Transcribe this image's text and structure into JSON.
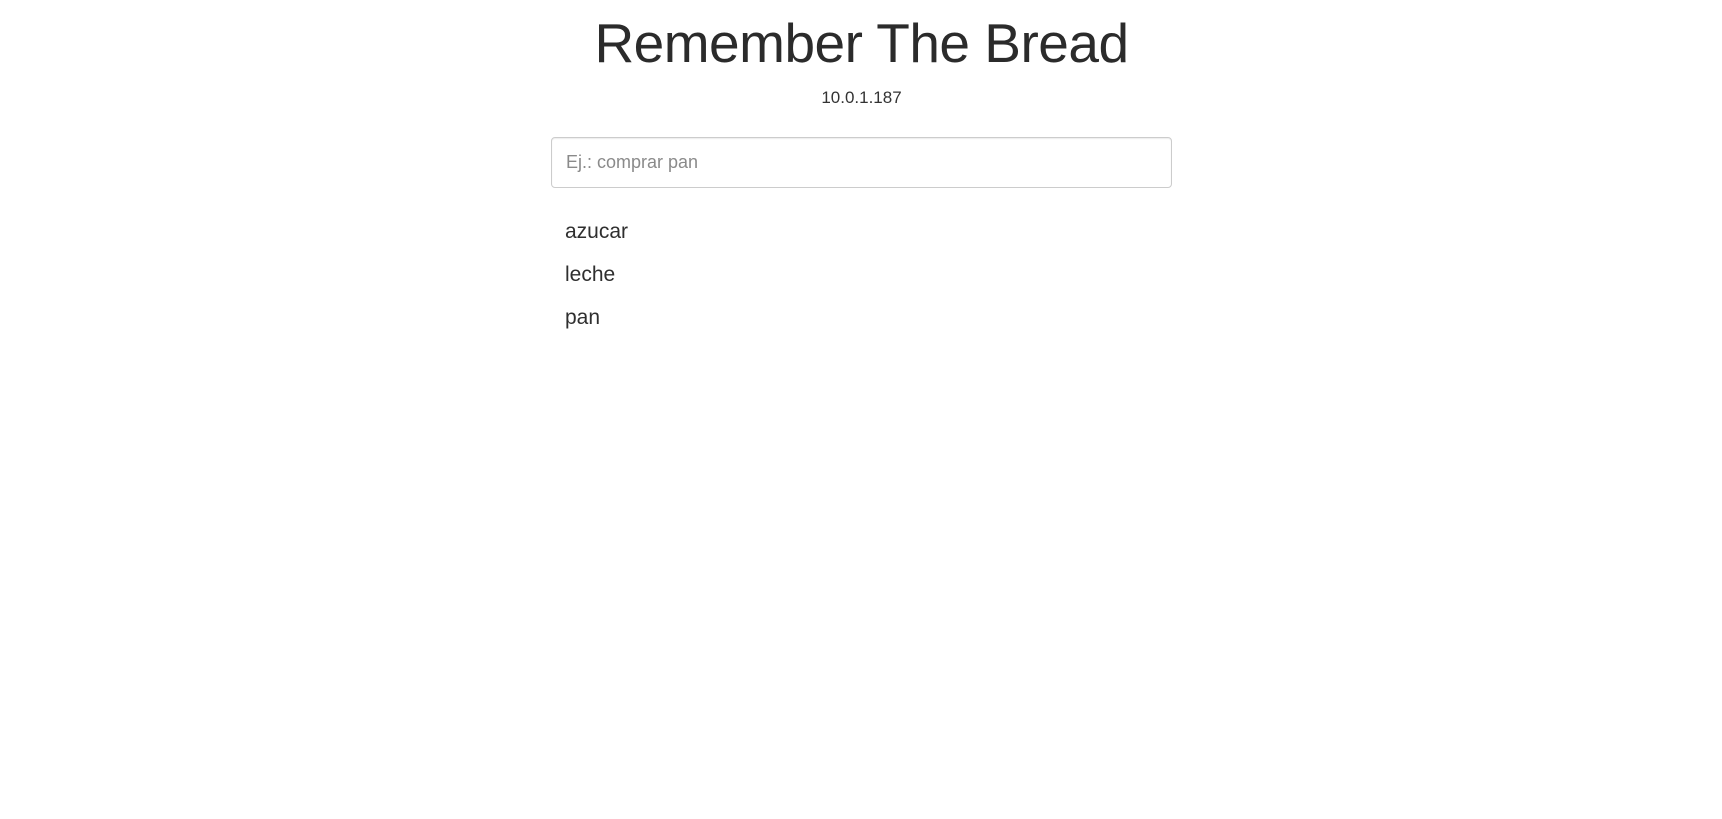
{
  "header": {
    "title": "Remember The Bread",
    "ip_address": "10.0.1.187"
  },
  "task_input": {
    "value": "",
    "placeholder": "Ej.: comprar pan"
  },
  "tasks": [
    {
      "label": "azucar"
    },
    {
      "label": "leche"
    },
    {
      "label": "pan"
    }
  ],
  "colors": {
    "background": "#ffffff",
    "text": "#333333",
    "input_border": "#cccccc"
  }
}
